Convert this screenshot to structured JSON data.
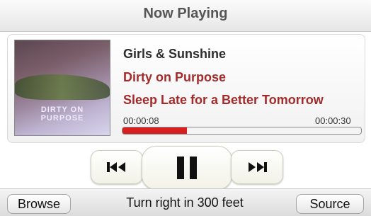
{
  "header": {
    "title": "Now Playing"
  },
  "album_art": {
    "caption": "DIRTY ON PURPOSE"
  },
  "track": {
    "artist": "Girls & Sunshine",
    "album": "Dirty on Purpose",
    "title": "Sleep Late for a Better Tomorrow"
  },
  "progress": {
    "elapsed": "00:00:08",
    "total": "00:00:30",
    "fraction": 0.27
  },
  "controls": {
    "prev_icon": "previous-track-icon",
    "play_icon": "pause-icon",
    "next_icon": "next-track-icon"
  },
  "bottom": {
    "browse_label": "Browse",
    "nav_text": "Turn right in 300 feet",
    "source_label": "Source"
  },
  "colors": {
    "accent_red": "#a52a2a",
    "progress_red": "#d81f1f"
  }
}
